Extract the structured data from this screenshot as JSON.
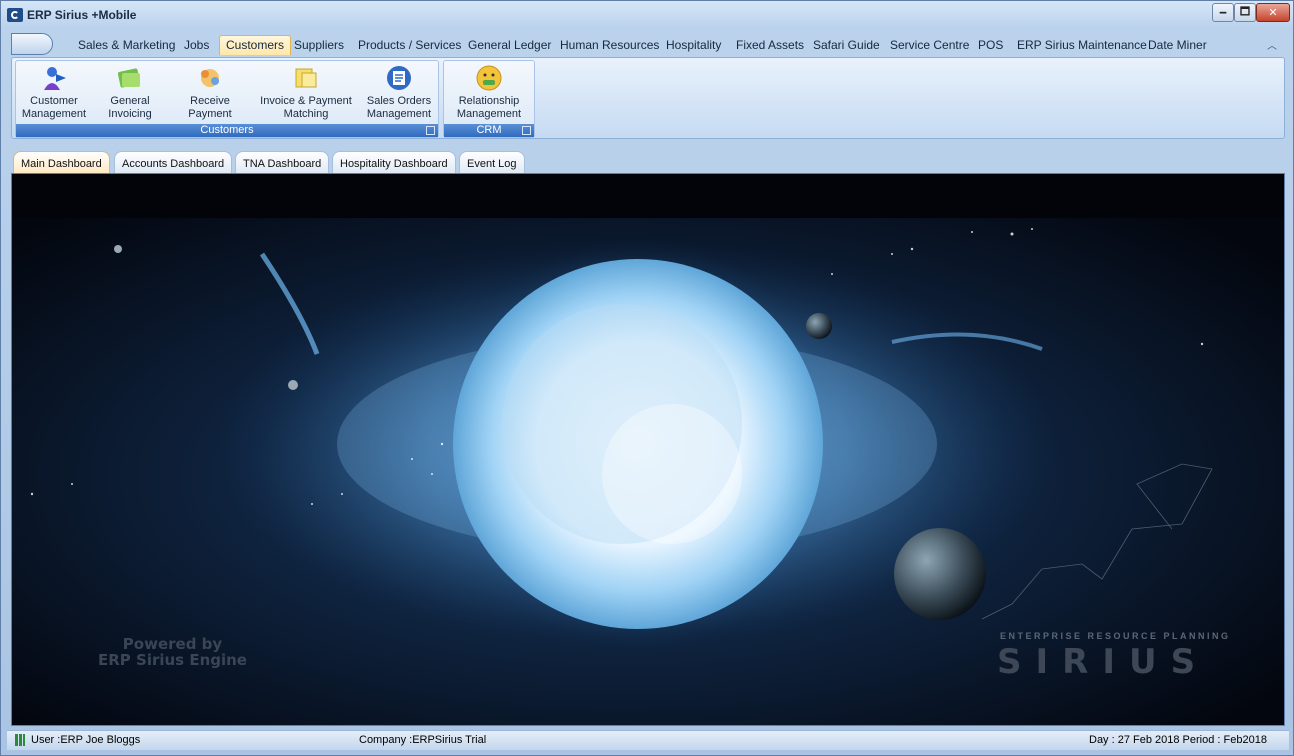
{
  "window": {
    "title": "ERP Sirius +Mobile",
    "min_label": "🗕",
    "max_label": "🗖",
    "close_label": "✕"
  },
  "ribbon": {
    "tabs": [
      {
        "label": "Sales & Marketing"
      },
      {
        "label": "Jobs"
      },
      {
        "label": "Customers",
        "active": true
      },
      {
        "label": "Suppliers"
      },
      {
        "label": "Products / Services"
      },
      {
        "label": "General Ledger"
      },
      {
        "label": "Human Resources"
      },
      {
        "label": "Hospitality"
      },
      {
        "label": "Fixed Assets"
      },
      {
        "label": "Safari Guide"
      },
      {
        "label": "Service Centre"
      },
      {
        "label": "POS"
      },
      {
        "label": "ERP Sirius Maintenance"
      },
      {
        "label": "Date Miner"
      }
    ],
    "groups": {
      "customers": {
        "caption": "Customers",
        "buttons": [
          {
            "line1": "Customer",
            "line2": "Management",
            "icon": "customer-management-icon"
          },
          {
            "line1": "General",
            "line2": "Invoicing",
            "icon": "general-invoicing-icon"
          },
          {
            "line1": "Receive",
            "line2": "Payment",
            "icon": "receive-payment-icon"
          },
          {
            "line1": "Invoice & Payment",
            "line2": "Matching",
            "icon": "invoice-matching-icon"
          },
          {
            "line1": "Sales Orders",
            "line2": "Management",
            "icon": "sales-orders-icon"
          }
        ]
      },
      "crm": {
        "caption": "CRM",
        "buttons": [
          {
            "line1": "Relationship",
            "line2": "Management",
            "icon": "relationship-management-icon"
          }
        ]
      }
    }
  },
  "dashboard_tabs": [
    {
      "label": "Main Dashboard",
      "active": true
    },
    {
      "label": "Accounts Dashboard"
    },
    {
      "label": "TNA Dashboard"
    },
    {
      "label": "Hospitality Dashboard"
    },
    {
      "label": "Event Log"
    }
  ],
  "branding": {
    "powered_line1": "Powered by",
    "powered_line2": "ERP Sirius Engine",
    "tagline": "ENTERPRISE RESOURCE PLANNING",
    "name": "SIRIUS"
  },
  "status": {
    "user": "User :ERP Joe Bloggs",
    "company": "Company :ERPSirius Trial",
    "day_period": "Day : 27 Feb 2018  Period : Feb2018"
  },
  "colors": {
    "active_tab": "#ffe7a8",
    "group_caption": "#2f6bbf",
    "content_bg": "#050a16"
  }
}
